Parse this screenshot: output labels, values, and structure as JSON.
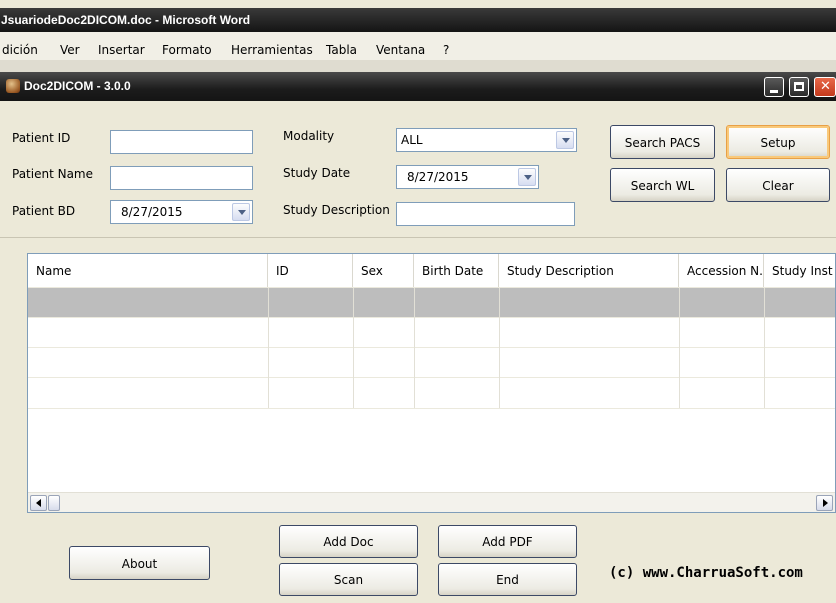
{
  "word": {
    "title": "JsuariodeDoc2DICOM.doc - Microsoft Word",
    "menu": [
      "dición",
      "Ver",
      "Insertar",
      "Formato",
      "Herramientas",
      "Tabla",
      "Ventana",
      "?"
    ]
  },
  "app": {
    "title": "Doc2DICOM - 3.0.0"
  },
  "form": {
    "patient_id_label": "Patient ID",
    "patient_id_value": "",
    "patient_name_label": "Patient Name",
    "patient_name_value": "",
    "patient_bd_label": "Patient BD",
    "patient_bd_value": "8/27/2015",
    "modality_label": "Modality",
    "modality_value": "ALL",
    "study_date_label": "Study Date",
    "study_date_value": "8/27/2015",
    "study_desc_label": "Study Description",
    "study_desc_value": ""
  },
  "buttons": {
    "search_pacs": "Search PACS",
    "setup": "Setup",
    "search_wl": "Search WL",
    "clear": "Clear",
    "about": "About",
    "add_doc": "Add Doc",
    "add_pdf": "Add PDF",
    "scan": "Scan",
    "end": "End"
  },
  "grid": {
    "columns": [
      "Name",
      "ID",
      "Sex",
      "Birth Date",
      "Study Description",
      "Accession N.",
      "Study Inst"
    ],
    "rows": []
  },
  "footer": {
    "copyright": "(c) www.CharruaSoft.com"
  }
}
